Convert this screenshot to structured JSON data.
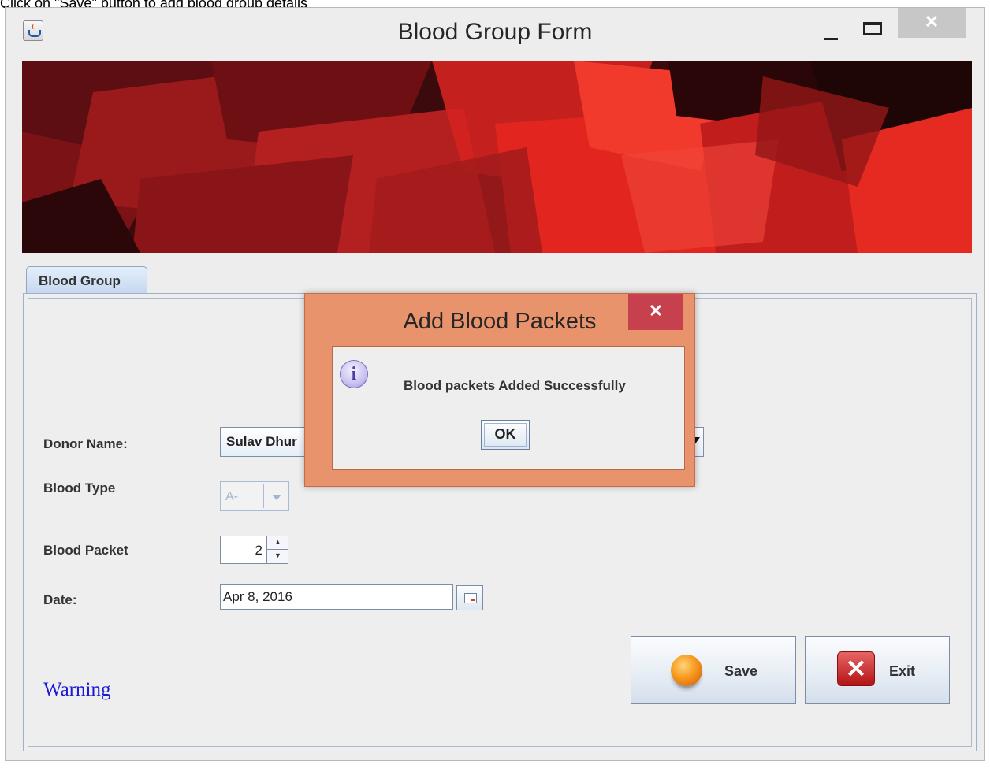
{
  "caption": "Click on \"Save\" button to add blood group details",
  "window": {
    "title": "Blood Group Form",
    "close_glyph": "✕"
  },
  "tab": {
    "label": "Blood Group"
  },
  "form": {
    "donor_label": "Donor Name:",
    "donor_value": "Sulav Dhur",
    "blood_type_label": "Blood Type",
    "blood_type_value": "A-",
    "blood_packet_label": "Blood Packet",
    "blood_packet_value": "2",
    "date_label": "Date:",
    "date_value": "Apr 8, 2016",
    "warning": "Warning"
  },
  "buttons": {
    "save": "Save",
    "exit": "Exit",
    "exit_glyph": "✕"
  },
  "dialog": {
    "title": "Add Blood Packets",
    "close_glyph": "✕",
    "info_glyph": "i",
    "message": "Blood packets Added Successfully",
    "ok": "OK"
  },
  "colors": {
    "banner_red": "#d81b1b",
    "dialog_frame": "#e9936c",
    "dialog_close": "#c6404d",
    "warning_text": "#1b1bd6"
  }
}
